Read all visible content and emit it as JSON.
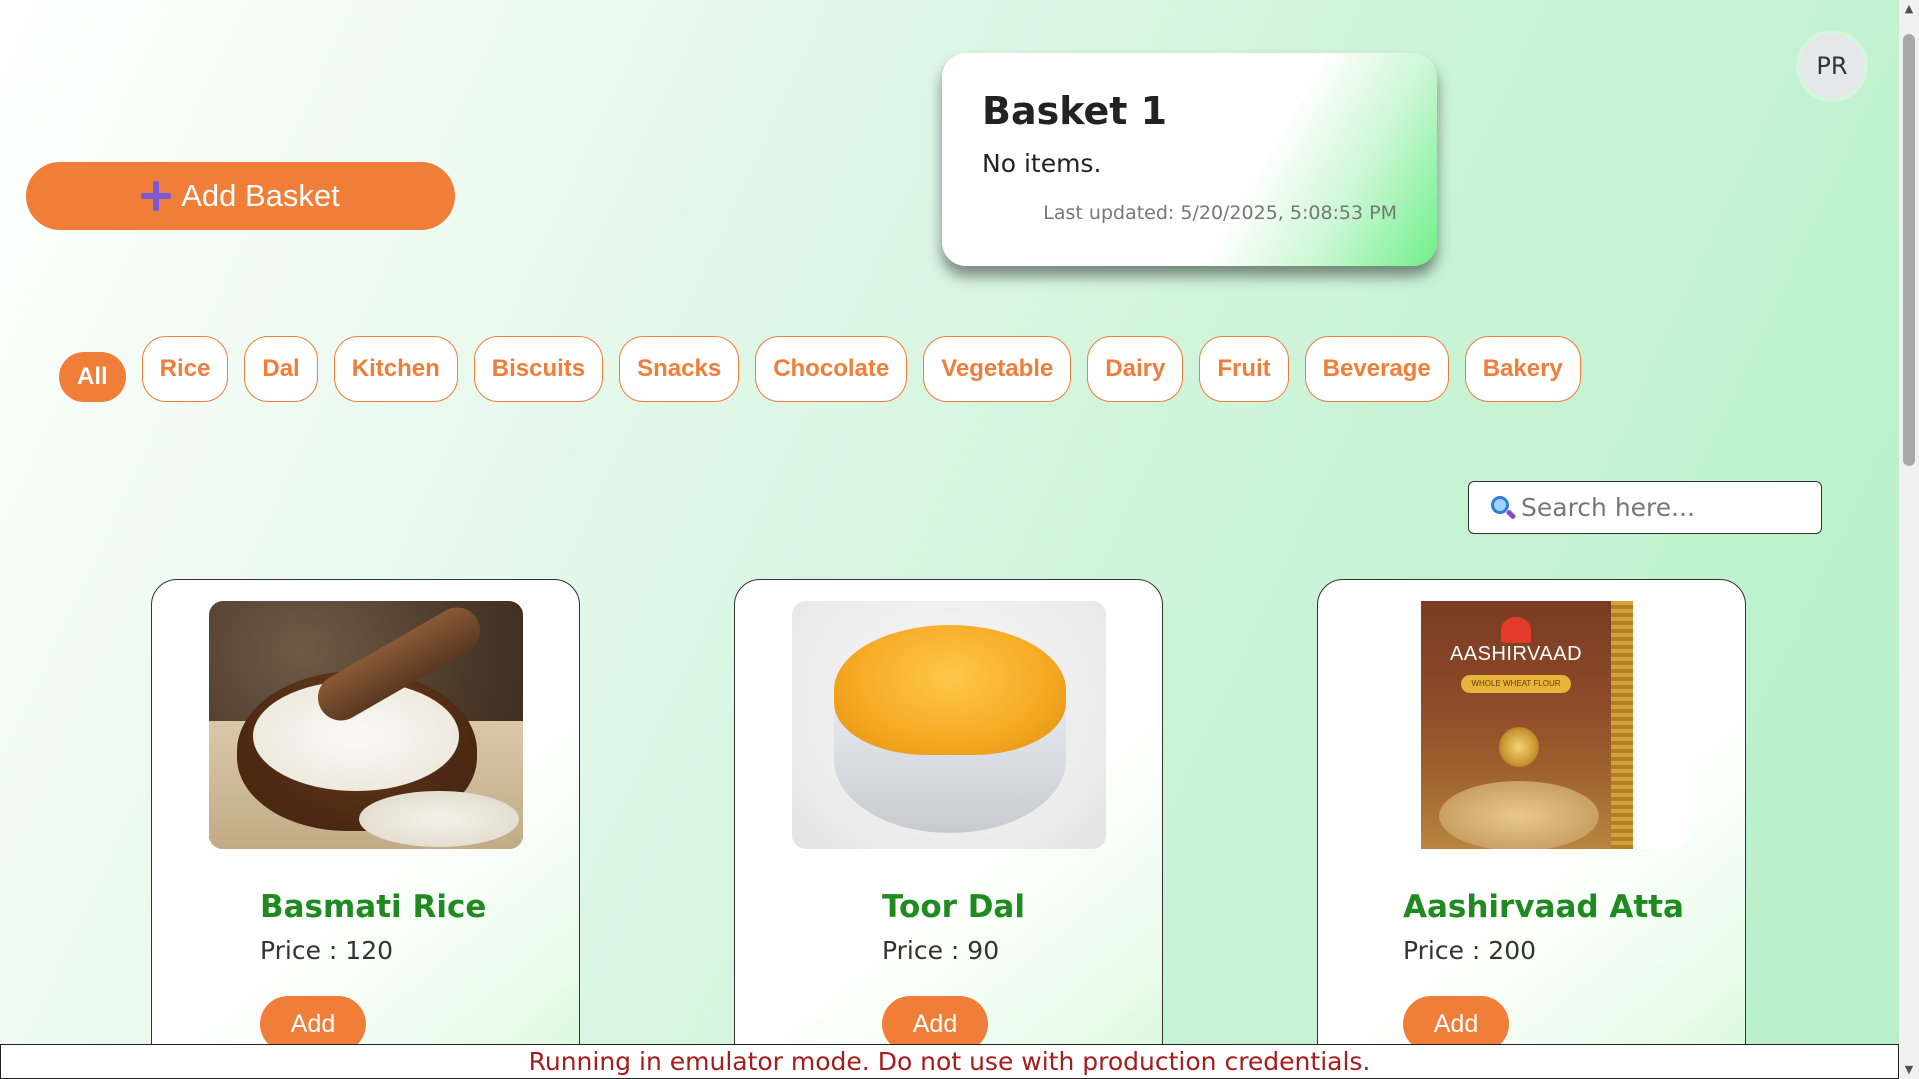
{
  "header": {
    "avatar_initials": "PR",
    "add_basket_label": "Add Basket"
  },
  "basket": {
    "title": "Basket 1",
    "items_text": "No items.",
    "last_updated": "Last updated: 5/20/2025, 5:08:53 PM"
  },
  "categories": {
    "active": "All",
    "items": [
      "Rice",
      "Dal",
      "Kitchen",
      "Biscuits",
      "Snacks",
      "Chocolate",
      "Vegetable",
      "Dairy",
      "Fruit",
      "Beverage",
      "Bakery"
    ]
  },
  "search": {
    "placeholder": "Search here...",
    "value": ""
  },
  "products": [
    {
      "name": "Basmati Rice",
      "price_label": "Price : 120",
      "add_label": "Add",
      "image": "rice-bowl-image"
    },
    {
      "name": "Toor Dal",
      "price_label": "Price : 90",
      "add_label": "Add",
      "image": "dal-bowl-image"
    },
    {
      "name": "Aashirvaad Atta",
      "price_label": "Price : 200",
      "add_label": "Add",
      "image": "atta-pack-image",
      "pack_brand": "AASHIRVAAD",
      "pack_tag": "WHOLE WHEAT FLOUR"
    }
  ],
  "banner": {
    "text": "Running in emulator mode. Do not use with production credentials."
  },
  "colors": {
    "accent": "#f07d38",
    "product_name": "#1f8a1f",
    "banner_text": "#a61b1b"
  }
}
